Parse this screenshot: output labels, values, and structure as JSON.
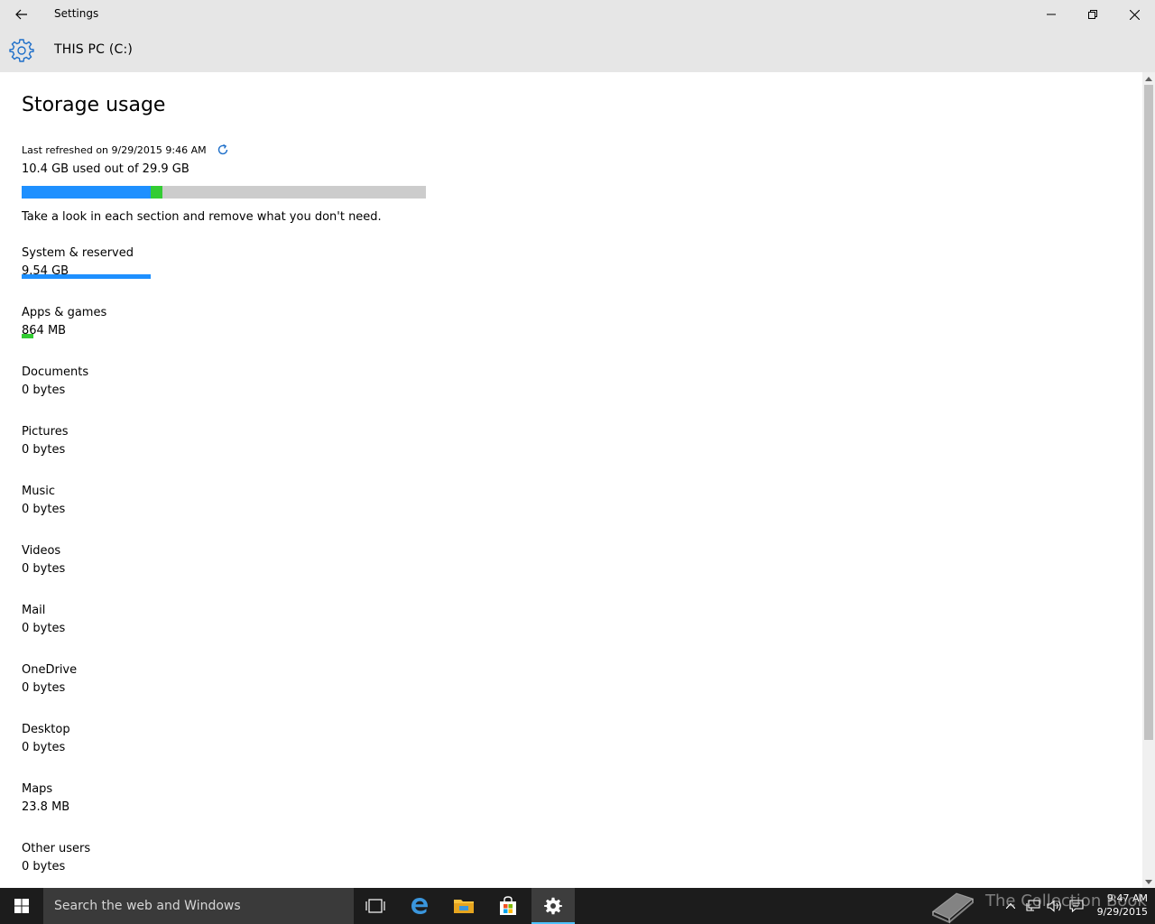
{
  "window": {
    "title": "Settings"
  },
  "header": {
    "title": "THIS PC (C:)"
  },
  "page": {
    "title": "Storage usage",
    "last_refreshed": "Last refreshed on 9/29/2015 9:46 AM",
    "used_summary": "10.4 GB used out of 29.9 GB",
    "hint": "Take a look in each section and remove what you don't need."
  },
  "usage_bar": {
    "total_gb": 29.9,
    "segments": [
      {
        "name": "System & reserved",
        "gb": 9.54,
        "color": "#1e90ff"
      },
      {
        "name": "Apps & games",
        "gb": 0.864,
        "color": "#33cc33"
      }
    ]
  },
  "categories": [
    {
      "name": "System & reserved",
      "size": "9.54 GB",
      "fraction": 0.319,
      "color": "#1e90ff"
    },
    {
      "name": "Apps & games",
      "size": "864 MB",
      "fraction": 0.029,
      "color": "#33cc33"
    },
    {
      "name": "Documents",
      "size": "0 bytes"
    },
    {
      "name": "Pictures",
      "size": "0 bytes"
    },
    {
      "name": "Music",
      "size": "0 bytes"
    },
    {
      "name": "Videos",
      "size": "0 bytes"
    },
    {
      "name": "Mail",
      "size": "0 bytes"
    },
    {
      "name": "OneDrive",
      "size": "0 bytes"
    },
    {
      "name": "Desktop",
      "size": "0 bytes"
    },
    {
      "name": "Maps",
      "size": "23.8 MB"
    },
    {
      "name": "Other users",
      "size": "0 bytes"
    }
  ],
  "taskbar": {
    "search_placeholder": "Search the web and Windows",
    "apps": [
      "task-view-icon",
      "edge-icon",
      "file-explorer-icon",
      "store-icon",
      "settings-icon"
    ],
    "clock_time": "9:47 AM",
    "clock_date": "9/29/2015"
  },
  "watermark": {
    "text": "The Collection Book"
  },
  "colors": {
    "accent": "#1e90ff",
    "apps": "#33cc33",
    "chrome": "#e6e6e6",
    "taskbar": "#1c1c1c"
  }
}
